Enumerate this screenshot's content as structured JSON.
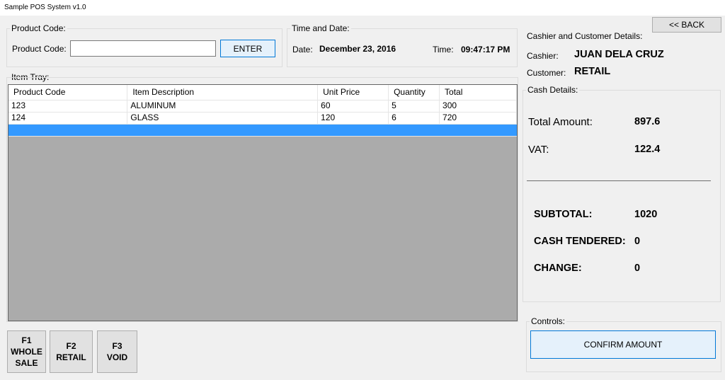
{
  "window": {
    "title": "Sample POS System v1.0"
  },
  "product_code_group": {
    "legend": "Product Code:",
    "label": "Product Code:",
    "input_value": "",
    "enter_label": "ENTER"
  },
  "time_date_group": {
    "legend": "Time and Date:",
    "date_label": "Date:",
    "date_value": "December 23, 2016",
    "time_label": "Time:",
    "time_value": "09:47:17 PM"
  },
  "back_button": {
    "label": "<< BACK"
  },
  "cashier_group": {
    "legend": "Cashier and Customer Details:",
    "cashier_label": "Cashier:",
    "cashier_value": "JUAN DELA CRUZ",
    "customer_label": "Customer:",
    "customer_value": "RETAIL"
  },
  "item_tray": {
    "legend": "Item Tray:",
    "columns": [
      "Product Code",
      "Item Description",
      "Unit Price",
      "Quantity",
      "Total"
    ],
    "rows": [
      [
        "123",
        "ALUMINUM",
        "60",
        "5",
        "300"
      ],
      [
        "124",
        "GLASS",
        "120",
        "6",
        "720"
      ],
      [
        "",
        "",
        "",
        "",
        ""
      ]
    ]
  },
  "cash_details": {
    "legend": "Cash Details:",
    "total_amount_label": "Total Amount:",
    "total_amount_value": "897.6",
    "vat_label": "VAT:",
    "vat_value": "122.4",
    "subtotal_label": "SUBTOTAL:",
    "subtotal_value": "1020",
    "cash_tendered_label": "CASH TENDERED:",
    "cash_tendered_value": "0",
    "change_label": "CHANGE:",
    "change_value": "0"
  },
  "controls": {
    "legend": "Controls:",
    "confirm_label": "CONFIRM AMOUNT"
  },
  "function_keys": [
    {
      "key": "F1",
      "lines": [
        "WHOLE",
        "SALE"
      ]
    },
    {
      "key": "F2",
      "lines": [
        "RETAIL"
      ]
    },
    {
      "key": "F3",
      "lines": [
        "VOID"
      ]
    }
  ]
}
